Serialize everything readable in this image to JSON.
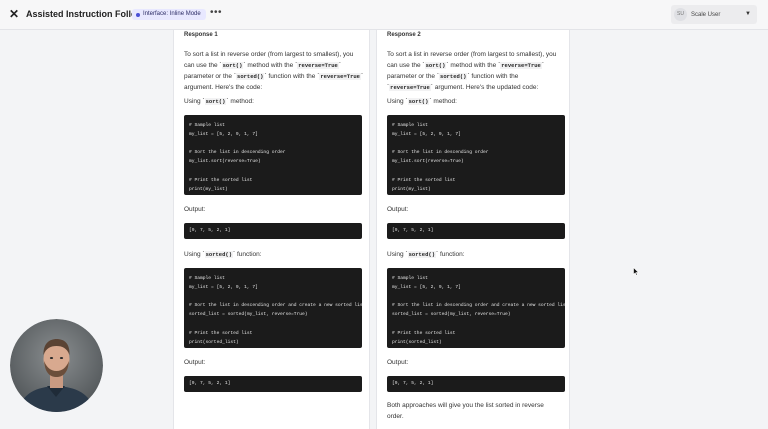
{
  "header": {
    "close_icon": "close-icon",
    "title": "Assisted Instruction Following",
    "mode_badge": "Interface: Inline Mode",
    "more_icon": "ellipsis-icon",
    "user": {
      "initials": "SU",
      "name": "Scale User"
    }
  },
  "responses": [
    {
      "label": "Response 1",
      "intro": [
        "To sort a list in reverse order (from largest to smallest), you can use the ",
        "`sort()`",
        " method with the ",
        "`reverse=True`",
        " parameter or the ",
        "`sorted()`",
        " function with the ",
        "`reverse=True`",
        " argument. Here's the code:"
      ],
      "using_sort": [
        "Using ",
        "`sort()`",
        " method:"
      ],
      "code_sort": [
        "# Sample list",
        "my_list = [5, 2, 9, 1, 7]",
        "",
        "# Sort the list in descending order",
        "my_list.sort(reverse=True)",
        "",
        "# Print the sorted list",
        "print(my_list)"
      ],
      "output_label_1": "Output:",
      "output_1": "[9, 7, 5, 2, 1]",
      "using_sorted": [
        "Using ",
        "`sorted()`",
        " function:"
      ],
      "code_sorted": [
        "# Sample list",
        "my_list = [5, 2, 9, 1, 7]",
        "",
        "# Sort the list in descending order and create a new sorted list",
        "sorted_list = sorted(my_list, reverse=True)",
        "",
        "# Print the sorted list",
        "print(sorted_list)"
      ],
      "output_label_2": "Output:",
      "output_2": "[9, 7, 5, 2, 1]"
    },
    {
      "label": "Response 2",
      "intro": [
        "To sort a list in reverse order (from largest to smallest), you can use the ",
        "`sort()`",
        " method with the ",
        "`reverse=True`",
        " parameter or the ",
        "`sorted()`",
        " function with the ",
        "`reverse=True`",
        " argument. Here's the updated code:"
      ],
      "using_sort": [
        "Using ",
        "`sort()`",
        " method:"
      ],
      "code_sort": [
        "# Sample list",
        "my_list = [5, 2, 9, 1, 7]",
        "",
        "# Sort the list in descending order",
        "my_list.sort(reverse=True)",
        "",
        "# Print the sorted list",
        "print(my_list)"
      ],
      "output_label_1": "Output:",
      "output_1": "[9, 7, 5, 2, 1]",
      "using_sorted": [
        "Using ",
        "`sorted()`",
        " function:"
      ],
      "code_sorted": [
        "# Sample list",
        "my_list = [5, 2, 9, 1, 7]",
        "",
        "# Sort the list in descending order and create a new sorted list",
        "sorted_list = sorted(my_list, reverse=True)",
        "",
        "# Print the sorted list",
        "print(sorted_list)"
      ],
      "output_label_2": "Output:",
      "output_2": "[9, 7, 5, 2, 1]",
      "closing": "Both approaches will give you the list sorted in reverse order."
    }
  ],
  "colors": {
    "code_bg": "#1b1b1b",
    "badge_bg": "#e8e8ff",
    "badge_dot": "#4a50d6"
  }
}
